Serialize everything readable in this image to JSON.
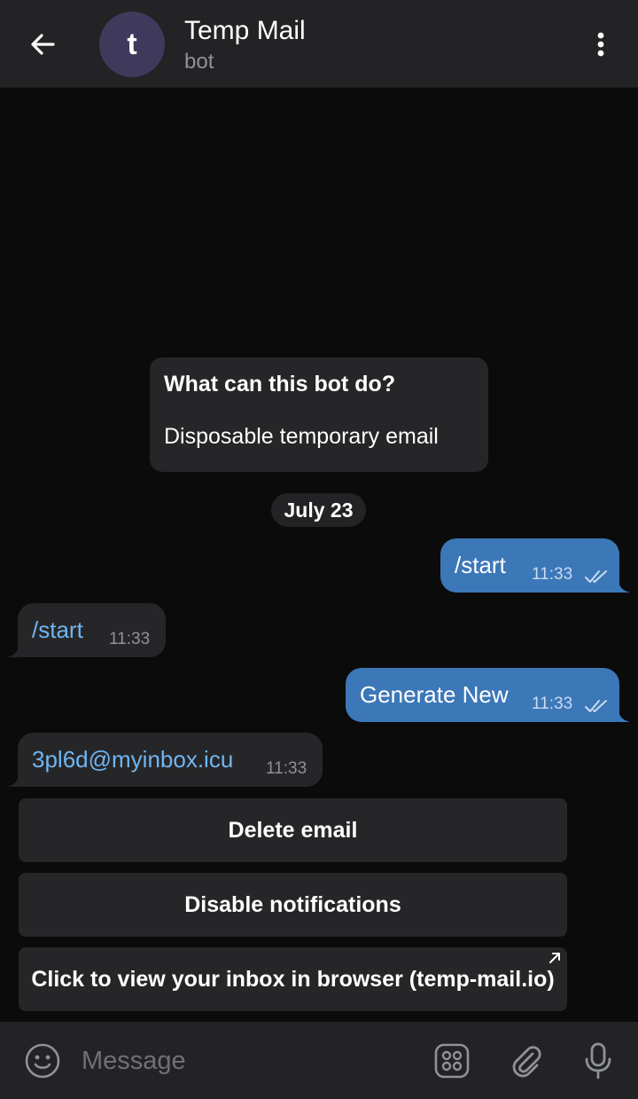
{
  "header": {
    "avatar_letter": "t",
    "title": "Temp Mail",
    "subtitle": "bot"
  },
  "intro": {
    "title": "What can this bot do?",
    "text": "Disposable temporary email"
  },
  "date_separator": "July 23",
  "messages": [
    {
      "direction": "out",
      "text": "/start",
      "time": "11:33",
      "status": "read"
    },
    {
      "direction": "in",
      "text": "/start",
      "time": "11:33"
    },
    {
      "direction": "out",
      "text": "Generate New",
      "time": "11:33",
      "status": "read"
    },
    {
      "direction": "in",
      "text": "3pl6d@myinbox.icu",
      "time": "11:33"
    }
  ],
  "keyboard": [
    {
      "label": "Delete email"
    },
    {
      "label": "Disable notifications"
    },
    {
      "label": "Click to view your inbox in browser (temp-mail.io)",
      "external": true
    }
  ],
  "composer": {
    "placeholder": "Message"
  },
  "colors": {
    "header_bg": "#232325",
    "chat_bg": "#0b0b0c",
    "outgoing_bubble": "#3c77b8",
    "incoming_bubble": "#262628",
    "link": "#6fb6f2",
    "avatar_bg": "#3f3a5c"
  },
  "icons": {
    "back": "arrow-left-icon",
    "menu": "kebab-menu-icon",
    "emoji": "emoji-icon",
    "bot_commands": "grid-icon",
    "attach": "paperclip-icon",
    "mic": "microphone-icon",
    "read_status": "double-check-icon",
    "external": "external-link-icon"
  }
}
